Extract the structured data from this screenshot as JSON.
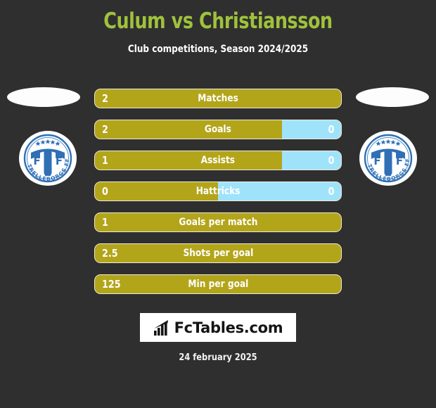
{
  "header": {
    "title": "Culum vs Christiansson",
    "subtitle": "Club competitions, Season 2024/2025",
    "title_color": "#9fc23c"
  },
  "teams": {
    "home": {
      "badge_name": "Trelleborgs FF",
      "badge_text": "TRELLEBORGS FF",
      "monogram": "F T F"
    },
    "away": {
      "badge_name": "Trelleborgs FF",
      "badge_text": "TRELLEBORGS FF",
      "monogram": "F T F"
    }
  },
  "colors": {
    "background": "#302f2f",
    "home_bar": "#b3a51a",
    "away_bar": "#9fe3fb",
    "bar_border": "#efeadb",
    "text": "#ffffff"
  },
  "stats": [
    {
      "label": "Matches",
      "home": "2",
      "away": "",
      "home_pct": 100,
      "away_pct": 0,
      "split": false
    },
    {
      "label": "Goals",
      "home": "2",
      "away": "0",
      "home_pct": 76,
      "away_pct": 24,
      "split": true
    },
    {
      "label": "Assists",
      "home": "1",
      "away": "0",
      "home_pct": 76,
      "away_pct": 24,
      "split": true
    },
    {
      "label": "Hattricks",
      "home": "0",
      "away": "0",
      "home_pct": 50,
      "away_pct": 50,
      "split": true
    },
    {
      "label": "Goals per match",
      "home": "1",
      "away": "",
      "home_pct": 100,
      "away_pct": 0,
      "split": false
    },
    {
      "label": "Shots per goal",
      "home": "2.5",
      "away": "",
      "home_pct": 100,
      "away_pct": 0,
      "split": false
    },
    {
      "label": "Min per goal",
      "home": "125",
      "away": "",
      "home_pct": 100,
      "away_pct": 0,
      "split": false
    }
  ],
  "footer": {
    "brand": "FcTables.com",
    "brand_icon": "bar-chart-icon",
    "date": "24 february 2025"
  }
}
